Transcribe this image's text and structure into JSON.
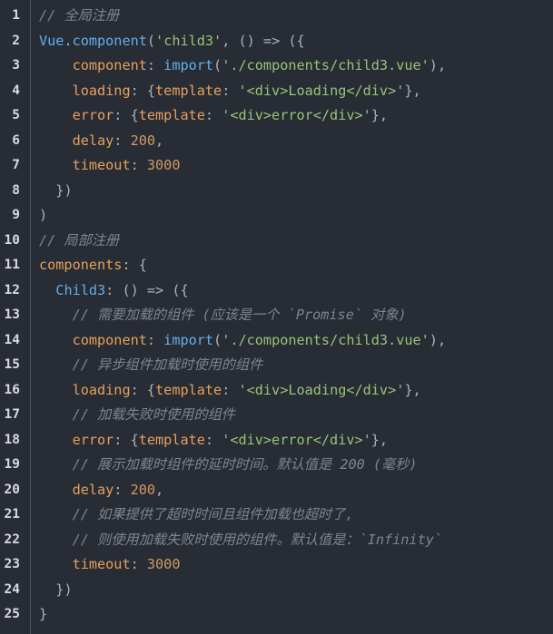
{
  "editor": {
    "lines": [
      {
        "num": "1",
        "indent": "",
        "tokens": [
          {
            "t": "// 全局注册",
            "c": "comment"
          }
        ]
      },
      {
        "num": "2",
        "indent": "",
        "tokens": [
          {
            "t": "Vue",
            "c": "obj"
          },
          {
            "t": ".",
            "c": "punc"
          },
          {
            "t": "component",
            "c": "func"
          },
          {
            "t": "(",
            "c": "punc"
          },
          {
            "t": "'child3'",
            "c": "str"
          },
          {
            "t": ", () => ({",
            "c": "punc"
          }
        ]
      },
      {
        "num": "3",
        "indent": "    ",
        "tokens": [
          {
            "t": "component",
            "c": "prop"
          },
          {
            "t": ": ",
            "c": "punc"
          },
          {
            "t": "import",
            "c": "func"
          },
          {
            "t": "(",
            "c": "punc"
          },
          {
            "t": "'./components/child3.vue'",
            "c": "str"
          },
          {
            "t": "),",
            "c": "punc"
          }
        ]
      },
      {
        "num": "4",
        "indent": "    ",
        "tokens": [
          {
            "t": "loading",
            "c": "prop"
          },
          {
            "t": ": {",
            "c": "punc"
          },
          {
            "t": "template",
            "c": "prop"
          },
          {
            "t": ": ",
            "c": "punc"
          },
          {
            "t": "'<div>Loading</div>'",
            "c": "str"
          },
          {
            "t": "},",
            "c": "punc"
          }
        ]
      },
      {
        "num": "5",
        "indent": "    ",
        "tokens": [
          {
            "t": "error",
            "c": "prop"
          },
          {
            "t": ": {",
            "c": "punc"
          },
          {
            "t": "template",
            "c": "prop"
          },
          {
            "t": ": ",
            "c": "punc"
          },
          {
            "t": "'<div>error</div>'",
            "c": "str"
          },
          {
            "t": "},",
            "c": "punc"
          }
        ]
      },
      {
        "num": "6",
        "indent": "    ",
        "tokens": [
          {
            "t": "delay",
            "c": "prop"
          },
          {
            "t": ": ",
            "c": "punc"
          },
          {
            "t": "200",
            "c": "num"
          },
          {
            "t": ",",
            "c": "punc"
          }
        ]
      },
      {
        "num": "7",
        "indent": "    ",
        "tokens": [
          {
            "t": "timeout",
            "c": "prop"
          },
          {
            "t": ": ",
            "c": "punc"
          },
          {
            "t": "3000",
            "c": "num"
          }
        ]
      },
      {
        "num": "8",
        "indent": "  ",
        "tokens": [
          {
            "t": "})",
            "c": "punc"
          }
        ]
      },
      {
        "num": "9",
        "indent": "",
        "tokens": [
          {
            "t": ")",
            "c": "punc"
          }
        ]
      },
      {
        "num": "10",
        "indent": "",
        "tokens": [
          {
            "t": "// 局部注册",
            "c": "comment"
          }
        ]
      },
      {
        "num": "11",
        "indent": "",
        "tokens": [
          {
            "t": "components",
            "c": "prop"
          },
          {
            "t": ": {",
            "c": "punc"
          }
        ]
      },
      {
        "num": "12",
        "indent": "  ",
        "tokens": [
          {
            "t": "Child3",
            "c": "ident"
          },
          {
            "t": ": () => ({",
            "c": "punc"
          }
        ]
      },
      {
        "num": "13",
        "indent": "    ",
        "tokens": [
          {
            "t": "// 需要加载的组件 (应该是一个 `Promise` 对象)",
            "c": "comment"
          }
        ]
      },
      {
        "num": "14",
        "indent": "    ",
        "tokens": [
          {
            "t": "component",
            "c": "prop"
          },
          {
            "t": ": ",
            "c": "punc"
          },
          {
            "t": "import",
            "c": "func"
          },
          {
            "t": "(",
            "c": "punc"
          },
          {
            "t": "'./components/child3.vue'",
            "c": "str"
          },
          {
            "t": "),",
            "c": "punc"
          }
        ]
      },
      {
        "num": "15",
        "indent": "    ",
        "tokens": [
          {
            "t": "// 异步组件加载时使用的组件",
            "c": "comment"
          }
        ]
      },
      {
        "num": "16",
        "indent": "    ",
        "tokens": [
          {
            "t": "loading",
            "c": "prop"
          },
          {
            "t": ": {",
            "c": "punc"
          },
          {
            "t": "template",
            "c": "prop"
          },
          {
            "t": ": ",
            "c": "punc"
          },
          {
            "t": "'<div>Loading</div>'",
            "c": "str"
          },
          {
            "t": "},",
            "c": "punc"
          }
        ]
      },
      {
        "num": "17",
        "indent": "    ",
        "tokens": [
          {
            "t": "// 加载失败时使用的组件",
            "c": "comment"
          }
        ]
      },
      {
        "num": "18",
        "indent": "    ",
        "tokens": [
          {
            "t": "error",
            "c": "prop"
          },
          {
            "t": ": {",
            "c": "punc"
          },
          {
            "t": "template",
            "c": "prop"
          },
          {
            "t": ": ",
            "c": "punc"
          },
          {
            "t": "'<div>error</div>'",
            "c": "str"
          },
          {
            "t": "},",
            "c": "punc"
          }
        ]
      },
      {
        "num": "19",
        "indent": "    ",
        "tokens": [
          {
            "t": "// 展示加载时组件的延时时间。默认值是 200 (毫秒)",
            "c": "comment"
          }
        ]
      },
      {
        "num": "20",
        "indent": "    ",
        "tokens": [
          {
            "t": "delay",
            "c": "prop"
          },
          {
            "t": ": ",
            "c": "punc"
          },
          {
            "t": "200",
            "c": "num"
          },
          {
            "t": ",",
            "c": "punc"
          }
        ]
      },
      {
        "num": "21",
        "indent": "    ",
        "tokens": [
          {
            "t": "// 如果提供了超时时间且组件加载也超时了,",
            "c": "comment"
          }
        ]
      },
      {
        "num": "22",
        "indent": "    ",
        "tokens": [
          {
            "t": "// 则使用加载失败时使用的组件。默认值是：`Infinity`",
            "c": "comment"
          }
        ]
      },
      {
        "num": "23",
        "indent": "    ",
        "tokens": [
          {
            "t": "timeout",
            "c": "prop"
          },
          {
            "t": ": ",
            "c": "punc"
          },
          {
            "t": "3000",
            "c": "num"
          }
        ]
      },
      {
        "num": "24",
        "indent": "  ",
        "tokens": [
          {
            "t": "})",
            "c": "punc"
          }
        ]
      },
      {
        "num": "25",
        "indent": "",
        "tokens": [
          {
            "t": "}",
            "c": "punc"
          }
        ]
      }
    ]
  },
  "colors": {
    "background": "#282c34",
    "line_number": "#d7dae0",
    "comment": "#7f848e",
    "string": "#98c379",
    "property": "#e5a15c",
    "function": "#61afef",
    "number": "#d19a66"
  }
}
